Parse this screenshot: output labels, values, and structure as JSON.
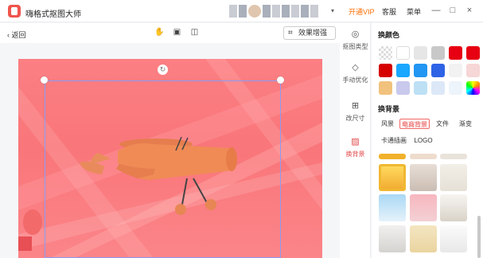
{
  "app": {
    "title": "嗨格式抠图大师",
    "vip": "开通VIP",
    "service": "客服",
    "menu": "菜单",
    "caret": "▾",
    "window_controls": [
      "—",
      "□",
      "×"
    ]
  },
  "toolbar": {
    "back": "返回",
    "enhance": "效果增强"
  },
  "side_tools": [
    {
      "label": "抠图类型",
      "icon": "toggle-icon"
    },
    {
      "label": "手动优化",
      "icon": "eraser-icon"
    },
    {
      "label": "改尺寸",
      "icon": "resize-icon"
    },
    {
      "label": "换背景",
      "icon": "background-icon"
    }
  ],
  "panel": {
    "color_title": "换颜色",
    "background_title": "换背景",
    "colors": [
      "transparent",
      "#ffffff",
      "#e6e6e6",
      "#c8c8c8",
      "#e60012",
      "#e60012",
      "#d60000",
      "#1aa7ff",
      "#2196f3",
      "#2e63e6",
      "#f2f2f2",
      "#f7d6d6",
      "#f1c27d",
      "#c8c9ec",
      "#bde0f5",
      "#dce8f7",
      "#eef4fb",
      "gradient"
    ],
    "tabs": [
      "风景",
      "电商背景",
      "文件",
      "渐变",
      "卡通插画",
      "LOGO"
    ],
    "active_tab": "电商背景"
  }
}
